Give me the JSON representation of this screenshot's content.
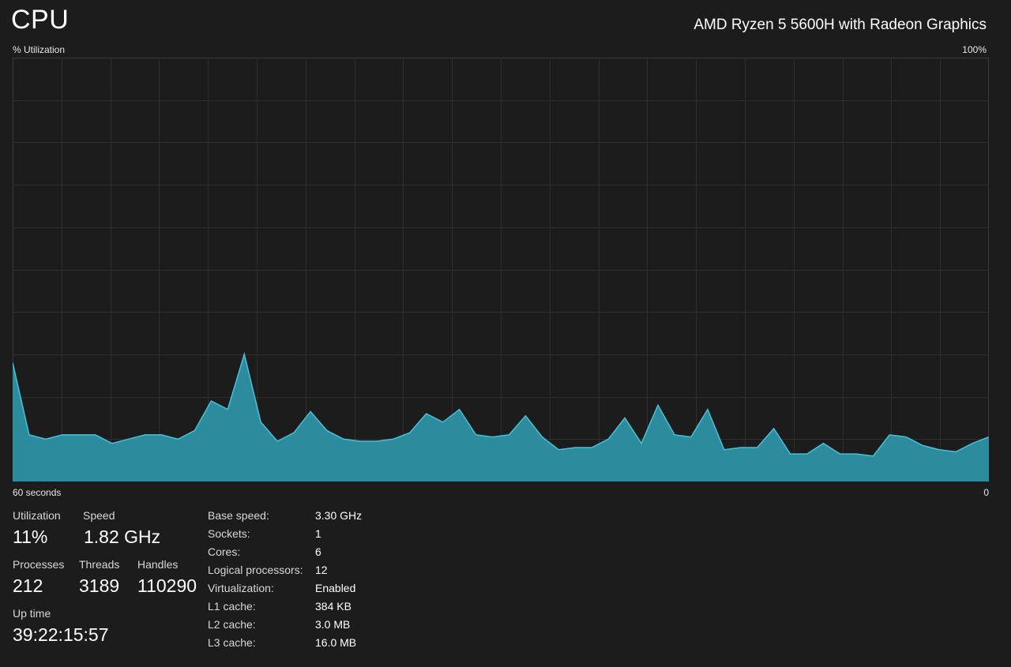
{
  "header": {
    "title": "CPU",
    "model": "AMD Ryzen 5 5600H with Radeon Graphics"
  },
  "chart": {
    "y_label": "% Utilization",
    "y_max_label": "100%",
    "x_left_label": "60 seconds",
    "x_right_label": "0"
  },
  "chart_data": {
    "type": "area",
    "xlabel": "60 seconds",
    "ylabel": "% Utilization",
    "xlim": [
      60,
      0
    ],
    "ylim": [
      0,
      100
    ],
    "grid": true,
    "series": [
      {
        "values": [
          28,
          11,
          10,
          11,
          11,
          11,
          9,
          10,
          11,
          11,
          10,
          12,
          19,
          17,
          30,
          14,
          9.5,
          11.5,
          16.5,
          12,
          10,
          9.5,
          9.5,
          10,
          11.5,
          16,
          14,
          17,
          11,
          10.5,
          11,
          15.5,
          10.5,
          7.5,
          8,
          8,
          10,
          15,
          9,
          18,
          11,
          10.5,
          17,
          7.5,
          8,
          8,
          12.5,
          6.5,
          6.5,
          9,
          6.5,
          6.5,
          6,
          11,
          10.5,
          8.5,
          7.5,
          7,
          9,
          10.5
        ],
        "color": "#2e95a8",
        "line_color": "#45c2d8"
      }
    ]
  },
  "stats": {
    "utilization": {
      "label": "Utilization",
      "value": "11%"
    },
    "speed": {
      "label": "Speed",
      "value": "1.82 GHz"
    },
    "processes": {
      "label": "Processes",
      "value": "212"
    },
    "threads": {
      "label": "Threads",
      "value": "3189"
    },
    "handles": {
      "label": "Handles",
      "value": "110290"
    },
    "uptime": {
      "label": "Up time",
      "value": "39:22:15:57"
    }
  },
  "specs": [
    {
      "label": "Base speed:",
      "value": "3.30 GHz"
    },
    {
      "label": "Sockets:",
      "value": "1"
    },
    {
      "label": "Cores:",
      "value": "6"
    },
    {
      "label": "Logical processors:",
      "value": "12"
    },
    {
      "label": "Virtualization:",
      "value": "Enabled"
    },
    {
      "label": "L1 cache:",
      "value": "384 KB"
    },
    {
      "label": "L2 cache:",
      "value": "3.0 MB"
    },
    {
      "label": "L3 cache:",
      "value": "16.0 MB"
    }
  ]
}
